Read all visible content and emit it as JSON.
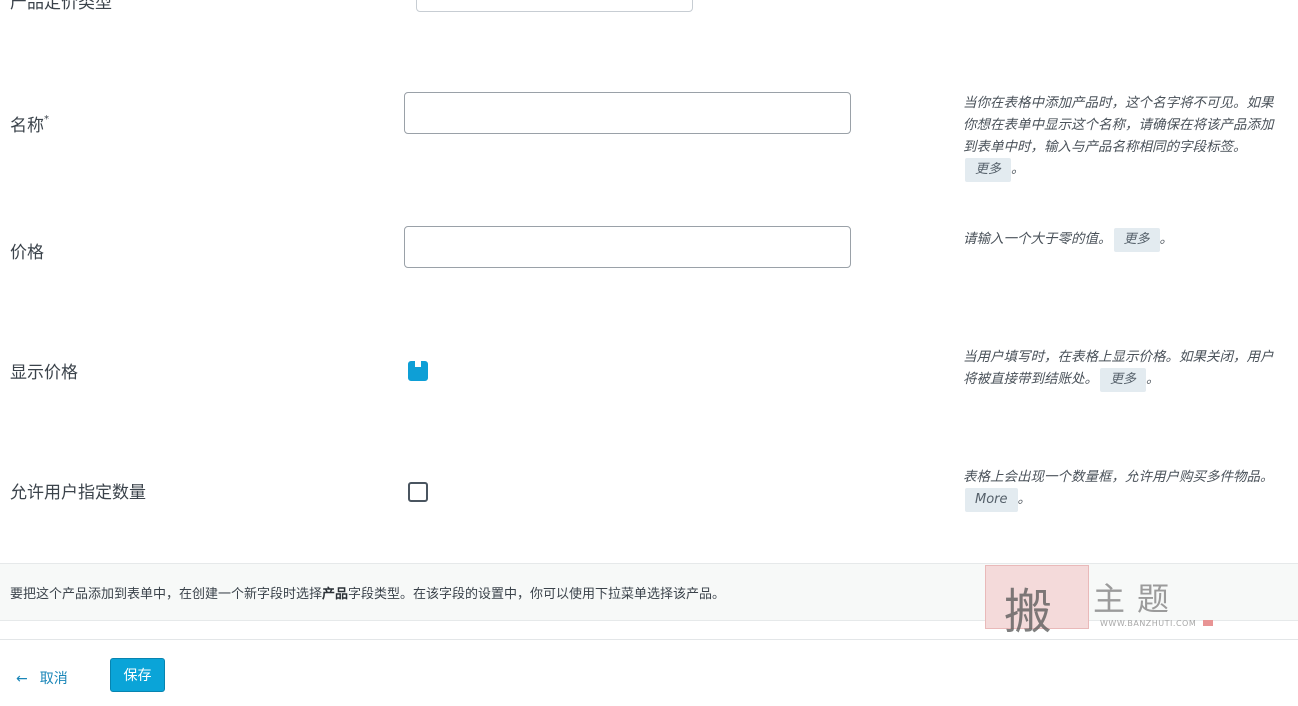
{
  "form": {
    "pricing_type": {
      "label": "产品定价类型"
    },
    "name": {
      "label": "名称",
      "required_mark": "*",
      "value": "",
      "help": "当你在表格中添加产品时，这个名字将不可见。如果你想在表单中显示这个名称，请确保在将该产品添加到表单中时，输入与产品名称相同的字段标签。",
      "more": "更多",
      "end": "。"
    },
    "price": {
      "label": "价格",
      "value": "",
      "help": "请输入一个大于零的值。",
      "more": "更多",
      "end": "。"
    },
    "show_price": {
      "label": "显示价格",
      "checked": true,
      "help": "当用户填写时，在表格上显示价格。如果关闭，用户将被直接带到结账处。",
      "more": "更多",
      "end": "。"
    },
    "allow_quantity": {
      "label": "允许用户指定数量",
      "checked": false,
      "help": "表格上会出现一个数量框，允许用户购买多件物品。",
      "more": "More",
      "end": "。"
    }
  },
  "info": {
    "before": "要把这个产品添加到表单中，在创建一个新字段时选择",
    "bold": "产品",
    "after": "字段类型。在该字段的设置中，你可以使用下拉菜单选择该产品。"
  },
  "actions": {
    "cancel_arrow": "←",
    "cancel": "取消",
    "save": "保存"
  },
  "watermark": {
    "seal": "搬",
    "title": "主题",
    "url": "WWW.BANZHUTI.COM"
  },
  "colors": {
    "accent": "#0aa4d8",
    "link": "#1a86b8"
  }
}
